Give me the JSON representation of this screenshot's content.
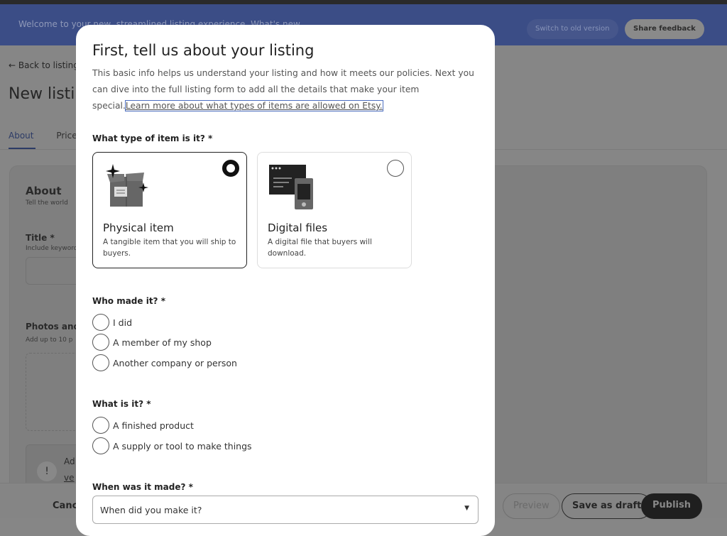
{
  "banner": {
    "message": "Welcome to your new, streamlined listing experience. What's new",
    "switch_label": "Switch to old version",
    "feedback_label": "Share feedback"
  },
  "page": {
    "back": "← Back to listings",
    "title": "New listing",
    "tabs": [
      "About",
      "Price"
    ],
    "about": {
      "heading": "About",
      "sub": "Tell the world",
      "title_label": "Title *",
      "title_hint": "Include keywords",
      "photos_label": "Photos and",
      "photos_hint": "Add up to 10 p",
      "alert_line1": "Ad",
      "alert_line2": "ve"
    }
  },
  "footer": {
    "cancel": "Cancel",
    "preview": "Preview",
    "save_draft": "Save as draft",
    "publish": "Publish"
  },
  "modal": {
    "title": "First, tell us about your listing",
    "desc": "This basic info helps us understand your listing and how it meets our policies. Next you can dive into the full listing form to add all the details that make your item special.",
    "learn_link": "Learn more about what types of items are allowed on Etsy.",
    "q_type": "What type of item is it? *",
    "types": [
      {
        "name": "Physical item",
        "desc": "A tangible item that you will ship to buyers.",
        "selected": true
      },
      {
        "name": "Digital files",
        "desc": "A digital file that buyers will download.",
        "selected": false
      }
    ],
    "q_who": "Who made it? *",
    "who": [
      "I did",
      "A member of my shop",
      "Another company or person"
    ],
    "q_what": "What is it? *",
    "what": [
      "A finished product",
      "A supply or tool to make things"
    ],
    "q_when": "When was it made? *",
    "when_placeholder": "When did you make it?"
  }
}
